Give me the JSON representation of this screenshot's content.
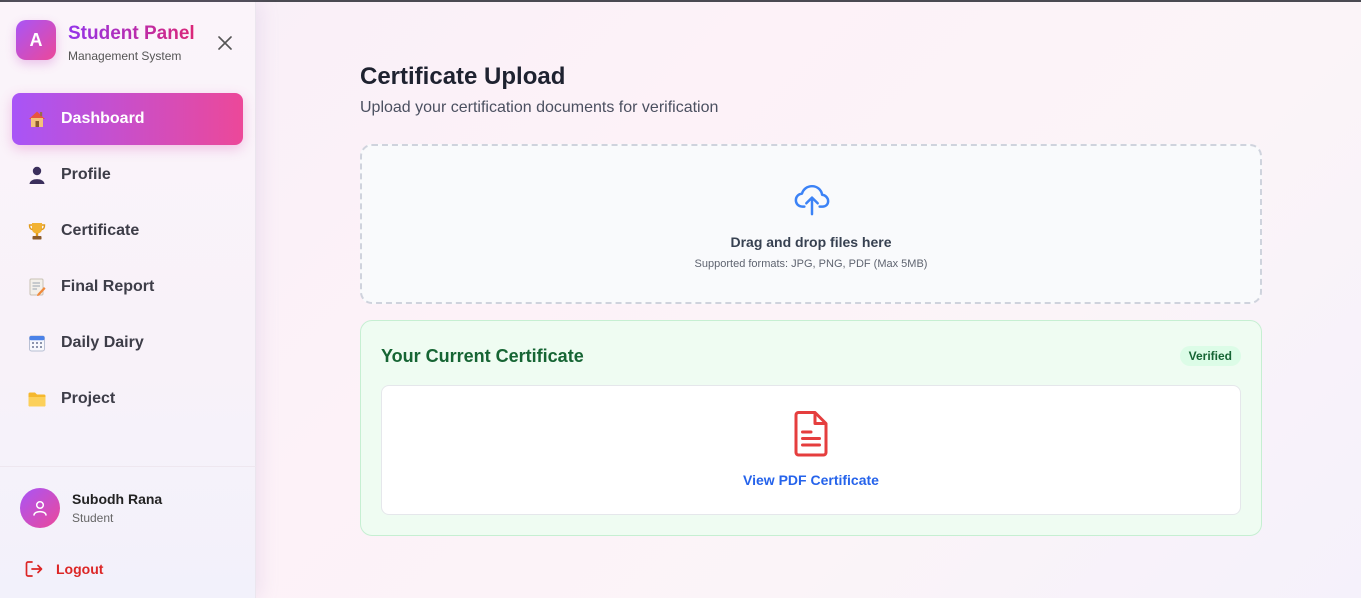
{
  "brand": {
    "logo_letter": "A",
    "title": "Student Panel",
    "subtitle": "Management System"
  },
  "nav": {
    "items": [
      {
        "label": "Dashboard",
        "icon": "house-icon",
        "active": true
      },
      {
        "label": "Profile",
        "icon": "person-icon",
        "active": false
      },
      {
        "label": "Certificate",
        "icon": "trophy-icon",
        "active": false
      },
      {
        "label": "Final Report",
        "icon": "memo-icon",
        "active": false
      },
      {
        "label": "Daily Dairy",
        "icon": "calendar-icon",
        "active": false
      },
      {
        "label": "Project",
        "icon": "folder-icon",
        "active": false
      }
    ]
  },
  "user": {
    "name": "Subodh Rana",
    "role": "Student"
  },
  "logout_label": "Logout",
  "main": {
    "title": "Certificate Upload",
    "subtitle": "Upload your certification documents for verification"
  },
  "dropzone": {
    "title": "Drag and drop files here",
    "hint": "Supported formats: JPG, PNG, PDF (Max 5MB)"
  },
  "certificate": {
    "title": "Your Current Certificate",
    "status": "Verified",
    "link_label": "View PDF Certificate"
  },
  "colors": {
    "accent_start": "#a855f7",
    "accent_end": "#ec4899",
    "verified_green": "#166534",
    "link_blue": "#2563eb",
    "logout_red": "#dc2626",
    "pdf_red": "#e53e3e"
  }
}
